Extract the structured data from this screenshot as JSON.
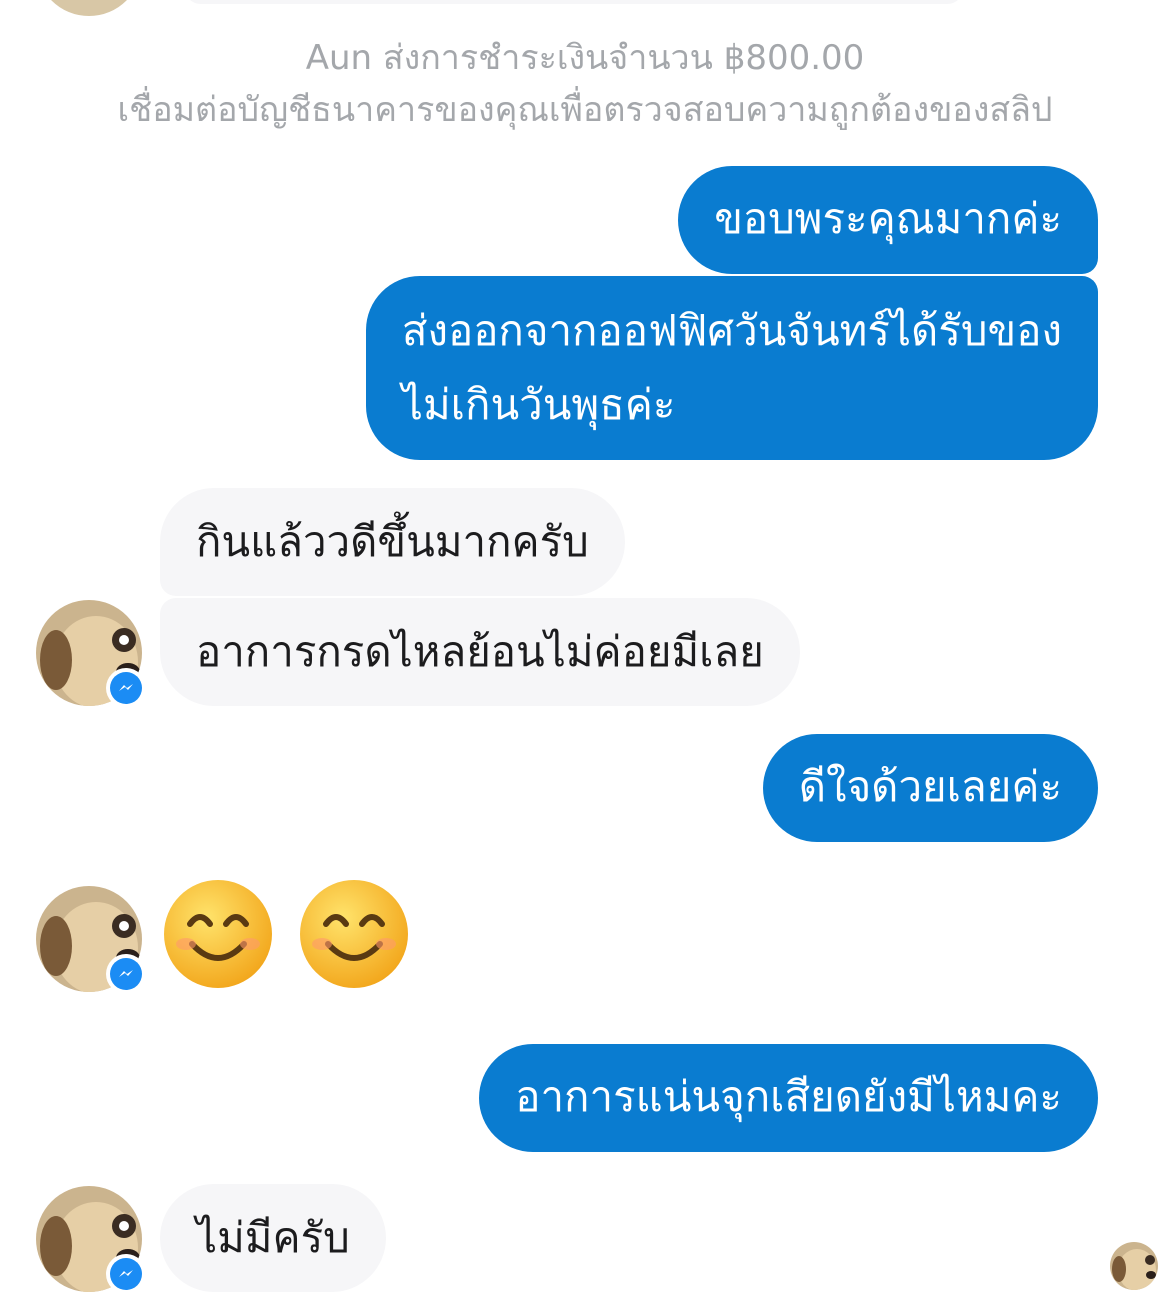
{
  "system_notice": {
    "payment_line": "Aun ส่งการชำระเงินจำนวน ฿800.00",
    "verify_line": "เชื่อมต่อบัญชีธนาคารของคุณเพื่อตรวจสอบความถูกต้องของสลิป"
  },
  "messages": [
    {
      "direction": "outgoing",
      "lines": [
        "ขอบพระคุณมากค่ะ"
      ]
    },
    {
      "direction": "outgoing",
      "lines": [
        "ส่งออกจากออฟฟิศวันจันทร์ได้รับของ",
        "ไม่เกินวันพุธค่ะ"
      ]
    },
    {
      "direction": "incoming",
      "lines": [
        "กินแล้ววดีขึ้นมากครับ"
      ]
    },
    {
      "direction": "incoming",
      "lines": [
        "อาการกรดไหลย้อนไม่ค่อยมีเลย"
      ]
    },
    {
      "direction": "outgoing",
      "lines": [
        "ดีใจด้วยเลยค่ะ"
      ]
    },
    {
      "direction": "incoming",
      "emoji": [
        "smiling-face-icon",
        "smiling-face-icon"
      ]
    },
    {
      "direction": "outgoing",
      "lines": [
        "อาการแน่นจุกเสียดยังมีไหมคะ"
      ]
    },
    {
      "direction": "incoming",
      "lines": [
        "ไม่มีครับ"
      ]
    }
  ],
  "colors": {
    "outgoing_bubble": "#0a7cd0",
    "incoming_bubble": "#f6f6f8",
    "system_text": "#a4a7ab",
    "messenger_badge": "#1b8cf4"
  }
}
